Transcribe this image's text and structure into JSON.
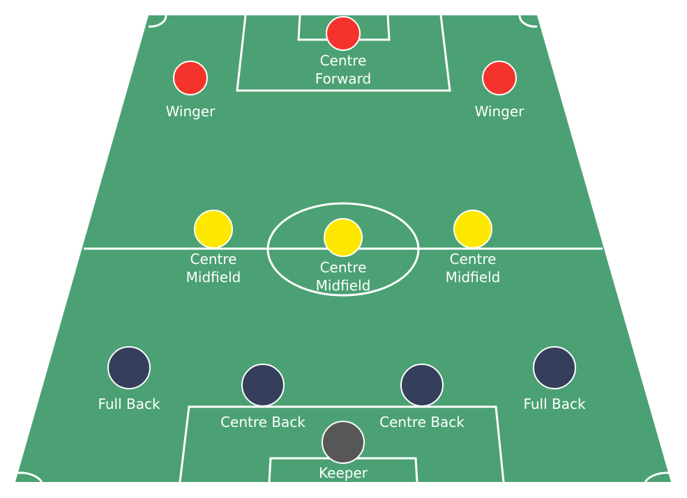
{
  "colors": {
    "pitch": "#4ba173",
    "lines": "#ffffff",
    "forward": "#f5332d",
    "midfield": "#ffe800",
    "defence": "#353f5c",
    "keeper": "#575757"
  },
  "players": [
    {
      "id": "centre-forward",
      "line1": "Centre",
      "line2": "Forward",
      "color_role": "forward"
    },
    {
      "id": "winger-left",
      "line1": "Winger",
      "line2": "",
      "color_role": "forward"
    },
    {
      "id": "winger-right",
      "line1": "Winger",
      "line2": "",
      "color_role": "forward"
    },
    {
      "id": "centre-midfield-left",
      "line1": "Centre",
      "line2": "Midfield",
      "color_role": "midfield"
    },
    {
      "id": "centre-midfield-centre",
      "line1": "Centre",
      "line2": "Midfield",
      "color_role": "midfield"
    },
    {
      "id": "centre-midfield-right",
      "line1": "Centre",
      "line2": "Midfield",
      "color_role": "midfield"
    },
    {
      "id": "full-back-left",
      "line1": "Full Back",
      "line2": "",
      "color_role": "defence"
    },
    {
      "id": "full-back-right",
      "line1": "Full Back",
      "line2": "",
      "color_role": "defence"
    },
    {
      "id": "centre-back-left",
      "line1": "Centre Back",
      "line2": "",
      "color_role": "defence"
    },
    {
      "id": "centre-back-right",
      "line1": "Centre Back",
      "line2": "",
      "color_role": "defence"
    },
    {
      "id": "keeper",
      "line1": "Keeper",
      "line2": "",
      "color_role": "keeper"
    }
  ]
}
